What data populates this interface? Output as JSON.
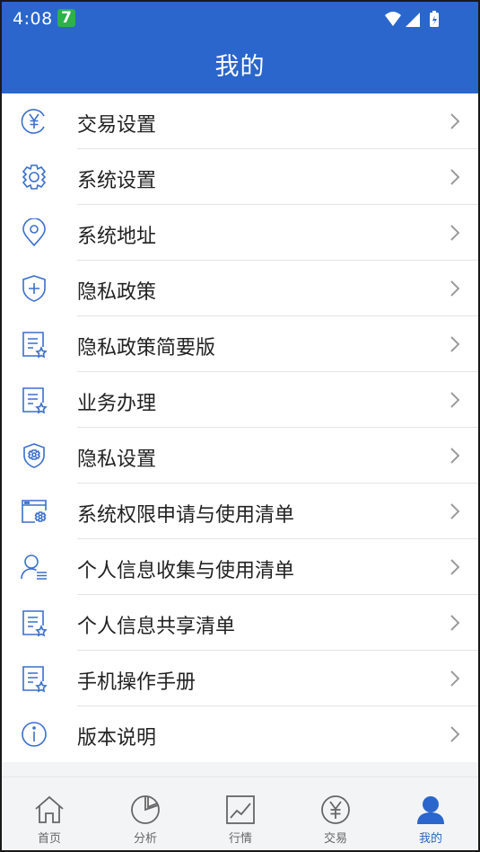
{
  "status_bar": {
    "time": "4:08",
    "badge": "7"
  },
  "header": {
    "title": "我的"
  },
  "menu": {
    "items": [
      {
        "label": "交易设置",
        "icon": "yuan-circle-icon"
      },
      {
        "label": "系统设置",
        "icon": "gear-icon"
      },
      {
        "label": "系统地址",
        "icon": "location-pin-icon"
      },
      {
        "label": "隐私政策",
        "icon": "shield-plus-icon"
      },
      {
        "label": "隐私政策简要版",
        "icon": "document-star-icon"
      },
      {
        "label": "业务办理",
        "icon": "document-star-icon"
      },
      {
        "label": "隐私设置",
        "icon": "shield-gear-icon"
      },
      {
        "label": "系统权限申请与使用清单",
        "icon": "window-gear-icon"
      },
      {
        "label": "个人信息收集与使用清单",
        "icon": "user-list-icon"
      },
      {
        "label": "个人信息共享清单",
        "icon": "document-star-icon"
      },
      {
        "label": "手机操作手册",
        "icon": "document-star-icon"
      },
      {
        "label": "版本说明",
        "icon": "info-circle-icon"
      }
    ]
  },
  "tabbar": {
    "tabs": [
      {
        "label": "首页",
        "icon": "home-icon"
      },
      {
        "label": "分析",
        "icon": "pie-chart-icon"
      },
      {
        "label": "行情",
        "icon": "line-chart-icon"
      },
      {
        "label": "交易",
        "icon": "yuan-circle-icon"
      },
      {
        "label": "我的",
        "icon": "person-icon",
        "active": true
      }
    ]
  },
  "colors": {
    "primary": "#2a66cc",
    "icon_blue": "#3a6fcc",
    "chevron": "#9a9a9a",
    "tab_gray": "#666666"
  }
}
